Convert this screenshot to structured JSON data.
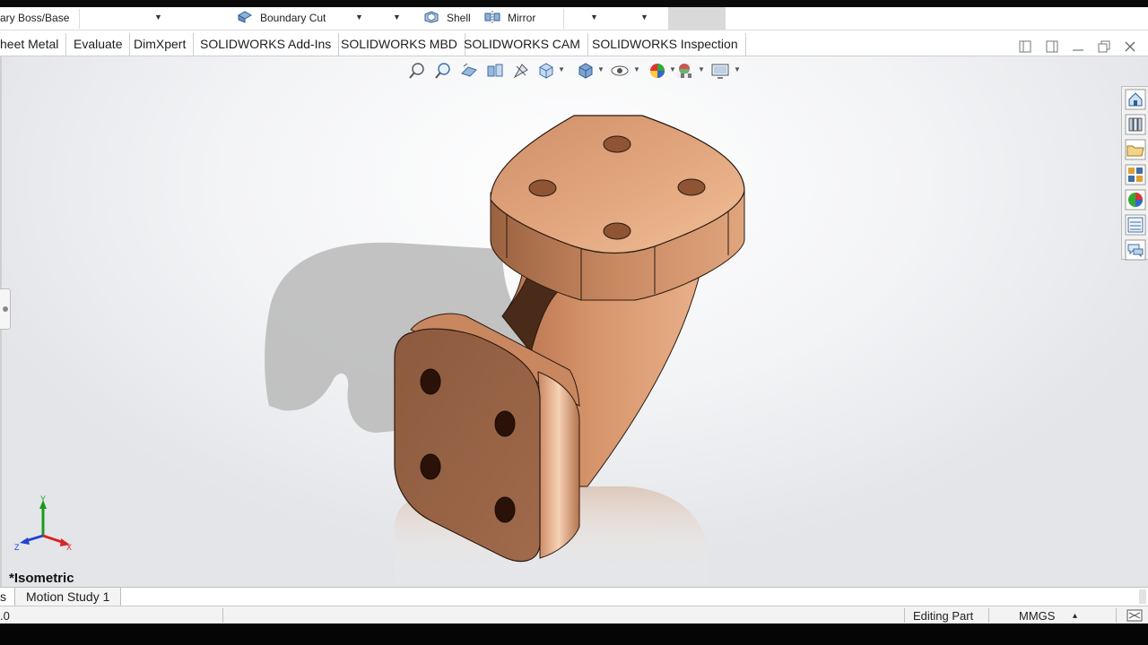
{
  "toolbar": {
    "boss_base_label": "ary Boss/Base",
    "boundary_cut_label": "Boundary Cut",
    "shell_label": "Shell",
    "mirror_label": "Mirror"
  },
  "command_tabs": [
    {
      "label": "heet Metal"
    },
    {
      "label": "Evaluate"
    },
    {
      "label": "DimXpert"
    },
    {
      "label": "SOLIDWORKS Add-Ins"
    },
    {
      "label": "SOLIDWORKS MBD"
    },
    {
      "label": "SOLIDWORKS CAM"
    },
    {
      "label": "SOLIDWORKS Inspection"
    }
  ],
  "viewport": {
    "view_name": "*Isometric",
    "triad": {
      "y": "Y",
      "z": "Z",
      "x": "X"
    }
  },
  "bottom_tabs": [
    {
      "label": "s"
    },
    {
      "label": "Motion Study 1"
    }
  ],
  "status_bar": {
    "left_text": ".0",
    "mode": "Editing Part",
    "units": "MMGS",
    "units_caret": "▴"
  },
  "colors": {
    "copper_light": "#e9b28a",
    "copper_mid": "#c9865e",
    "copper_dark": "#7a4a30",
    "shadow": "#b3b3b3"
  }
}
